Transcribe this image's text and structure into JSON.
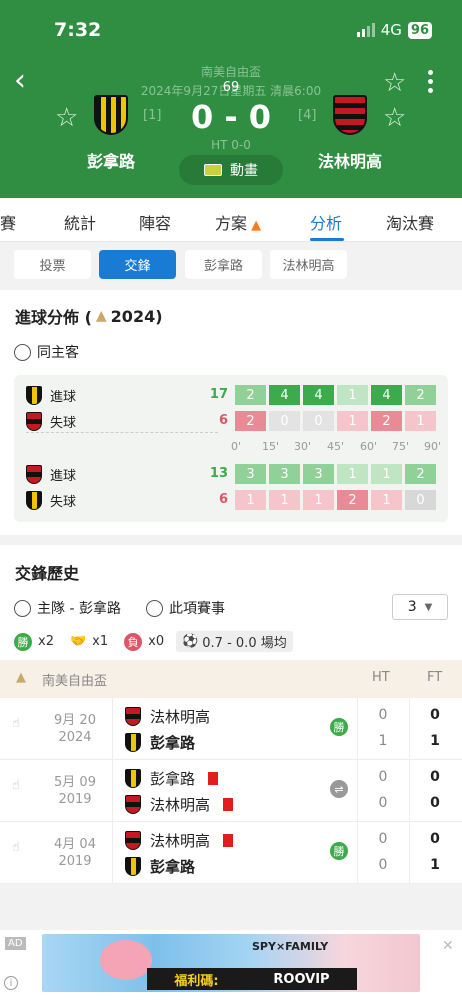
{
  "status_bar": {
    "time": "7:32",
    "network": "4G",
    "battery": "96"
  },
  "match": {
    "competition": "南美自由盃",
    "datetime": "2024年9月27日星期五 清晨6:00",
    "minute": "69",
    "score": "0 - 0",
    "halftime": "HT 0-0",
    "home": {
      "name": "彭拿路",
      "rank": "[1]"
    },
    "away": {
      "name": "法林明高",
      "rank": "[4]"
    },
    "animation_label": "動畫"
  },
  "tabs": [
    "聯賽",
    "統計",
    "陣容",
    "方案",
    "分析",
    "淘汰賽"
  ],
  "subtabs": [
    "投票",
    "交鋒",
    "彭拿路",
    "法林明高"
  ],
  "goal_distribution": {
    "title": "進球分佈 (",
    "title_year": "2024)",
    "filter_label": "同主客",
    "ticks": [
      "0'",
      "15'",
      "30'",
      "45'",
      "60'",
      "75'",
      "90'"
    ],
    "rows": [
      {
        "label": "進球",
        "total": "17",
        "values": [
          "2",
          "4",
          "4",
          "1",
          "4",
          "2"
        ]
      },
      {
        "label": "失球",
        "total": "6",
        "values": [
          "2",
          "0",
          "0",
          "1",
          "2",
          "1"
        ]
      },
      {
        "label": "進球",
        "total": "13",
        "values": [
          "3",
          "3",
          "3",
          "1",
          "1",
          "2"
        ]
      },
      {
        "label": "失球",
        "total": "6",
        "values": [
          "1",
          "1",
          "1",
          "2",
          "1",
          "0"
        ]
      }
    ]
  },
  "h2h": {
    "title": "交鋒歷史",
    "filter_home": "主隊 - 彭拿路",
    "filter_comp": "此項賽事",
    "count": "3",
    "summary": {
      "win_badge": "勝",
      "wins": "x2",
      "draws": "x1",
      "loss_badge": "負",
      "losses": "x0",
      "goals": "0.7 - 0.0 場均"
    },
    "header": {
      "competition": "南美自由盃",
      "ht": "HT",
      "ft": "FT"
    },
    "matches": [
      {
        "date": "9月 20",
        "year": "2024",
        "home": "法林明高",
        "away": "彭拿路",
        "result": "勝",
        "ht_home": "0",
        "ht_away": "1",
        "ft_home": "0",
        "ft_away": "1"
      },
      {
        "date": "5月 09",
        "year": "2019",
        "home": "彭拿路",
        "away": "法林明高",
        "result": "和",
        "ht_home": "0",
        "ht_away": "0",
        "ft_home": "0",
        "ft_away": "0"
      },
      {
        "date": "4月 04",
        "year": "2019",
        "home": "法林明高",
        "away": "彭拿路",
        "result": "勝",
        "ht_home": "0",
        "ht_away": "0",
        "ft_home": "0",
        "ft_away": "1"
      }
    ]
  },
  "ad": {
    "tag": "AD",
    "banner_text": "福利碼:",
    "code": "ROOVIP",
    "series": "SPY×FAMILY"
  },
  "colors": {
    "header_green": "#2f8e41",
    "accent_blue": "#1a7bd4",
    "win_green": "#3daa4c",
    "loss_red": "#e05565"
  }
}
